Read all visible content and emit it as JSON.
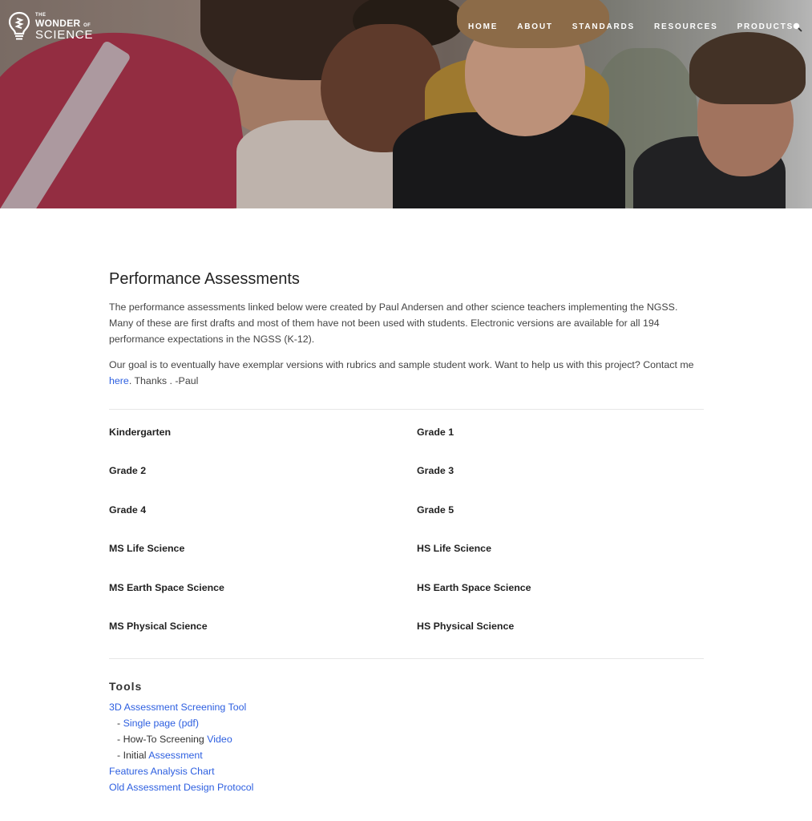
{
  "header": {
    "logo": {
      "the": "THE",
      "wonder": "WONDER",
      "of": "OF",
      "science": "SCIENCE",
      "icon": "lightbulb-icon"
    },
    "nav": [
      {
        "label": "HOME"
      },
      {
        "label": "ABOUT"
      },
      {
        "label": "STANDARDS"
      },
      {
        "label": "RESOURCES"
      },
      {
        "label": "PRODUCTS"
      }
    ],
    "search_icon": "search-icon"
  },
  "hero": {
    "description": "Students leaning over working together"
  },
  "main": {
    "title": "Performance Assessments",
    "intro": "The performance assessments linked below were created by Paul Andersen and other science teachers implementing the NGSS. Many of these are first drafts and most of them have not been used with students.  Electronic versions are available for all 194 performance expectations in the NGSS (K-12).",
    "goal_before": "Our goal is to eventually have exemplar versions with rubrics and sample student work.  Want to help us with this project?  Contact me ",
    "goal_link": "here",
    "goal_after": ".  Thanks . -Paul",
    "grades": [
      {
        "label": "Kindergarten"
      },
      {
        "label": "Grade 1"
      },
      {
        "label": "Grade 2"
      },
      {
        "label": "Grade 3"
      },
      {
        "label": "Grade 4"
      },
      {
        "label": "Grade 5"
      },
      {
        "label": "MS Life Science"
      },
      {
        "label": "HS Life Science"
      },
      {
        "label": "MS Earth Space Science"
      },
      {
        "label": "HS Earth Space Science"
      },
      {
        "label": "MS Physical Science"
      },
      {
        "label": "HS Physical Science"
      }
    ],
    "tools": {
      "title": "Tools",
      "screening_tool": "3D Assessment Screening Tool",
      "single_page_prefix": "- ",
      "single_page_link": "Single page (pdf)",
      "howto_prefix": "- How-To Screening ",
      "howto_link": "Video",
      "initial_prefix": "- Initial ",
      "initial_link": "Assessment",
      "features_chart": "Features Analysis Chart",
      "old_protocol": "Old Assessment Design Protocol"
    }
  },
  "colors": {
    "link": "#2d5fe0",
    "text": "#444444",
    "heading": "#222222",
    "divider": "#e6e6e6"
  }
}
